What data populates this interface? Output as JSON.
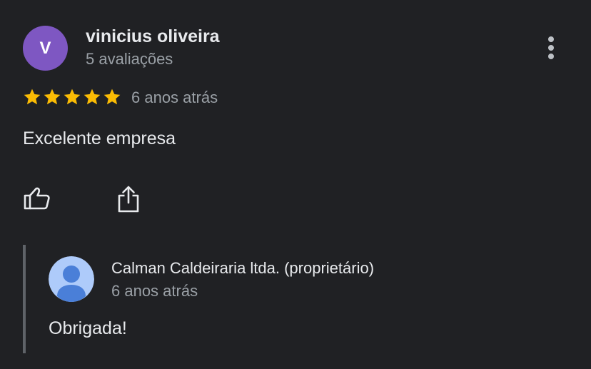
{
  "review": {
    "avatar_letter": "V",
    "avatar_color": "#7e57c2",
    "reviewer_name": "vinicius oliveira",
    "review_count": "5 avaliações",
    "rating": 5,
    "rating_max": 5,
    "star_color": "#fbbc04",
    "date": "6 anos atrás",
    "text": "Excelente empresa",
    "more_icon": "more-vert-icon",
    "like_icon": "thumb-up-icon",
    "share_icon": "share-icon"
  },
  "reply": {
    "owner_name": "Calman Caldeiraria ltda. (proprietário)",
    "date": "6 anos atrás",
    "text": "Obrigada!",
    "avatar_icon": "default-person-avatar"
  },
  "colors": {
    "background": "#202124",
    "text_primary": "#e8eaed",
    "text_secondary": "#9aa0a6",
    "reply_bar": "#5f6368",
    "owner_avatar_bg": "#aecbfa",
    "owner_avatar_fg": "#4a7fd8"
  }
}
